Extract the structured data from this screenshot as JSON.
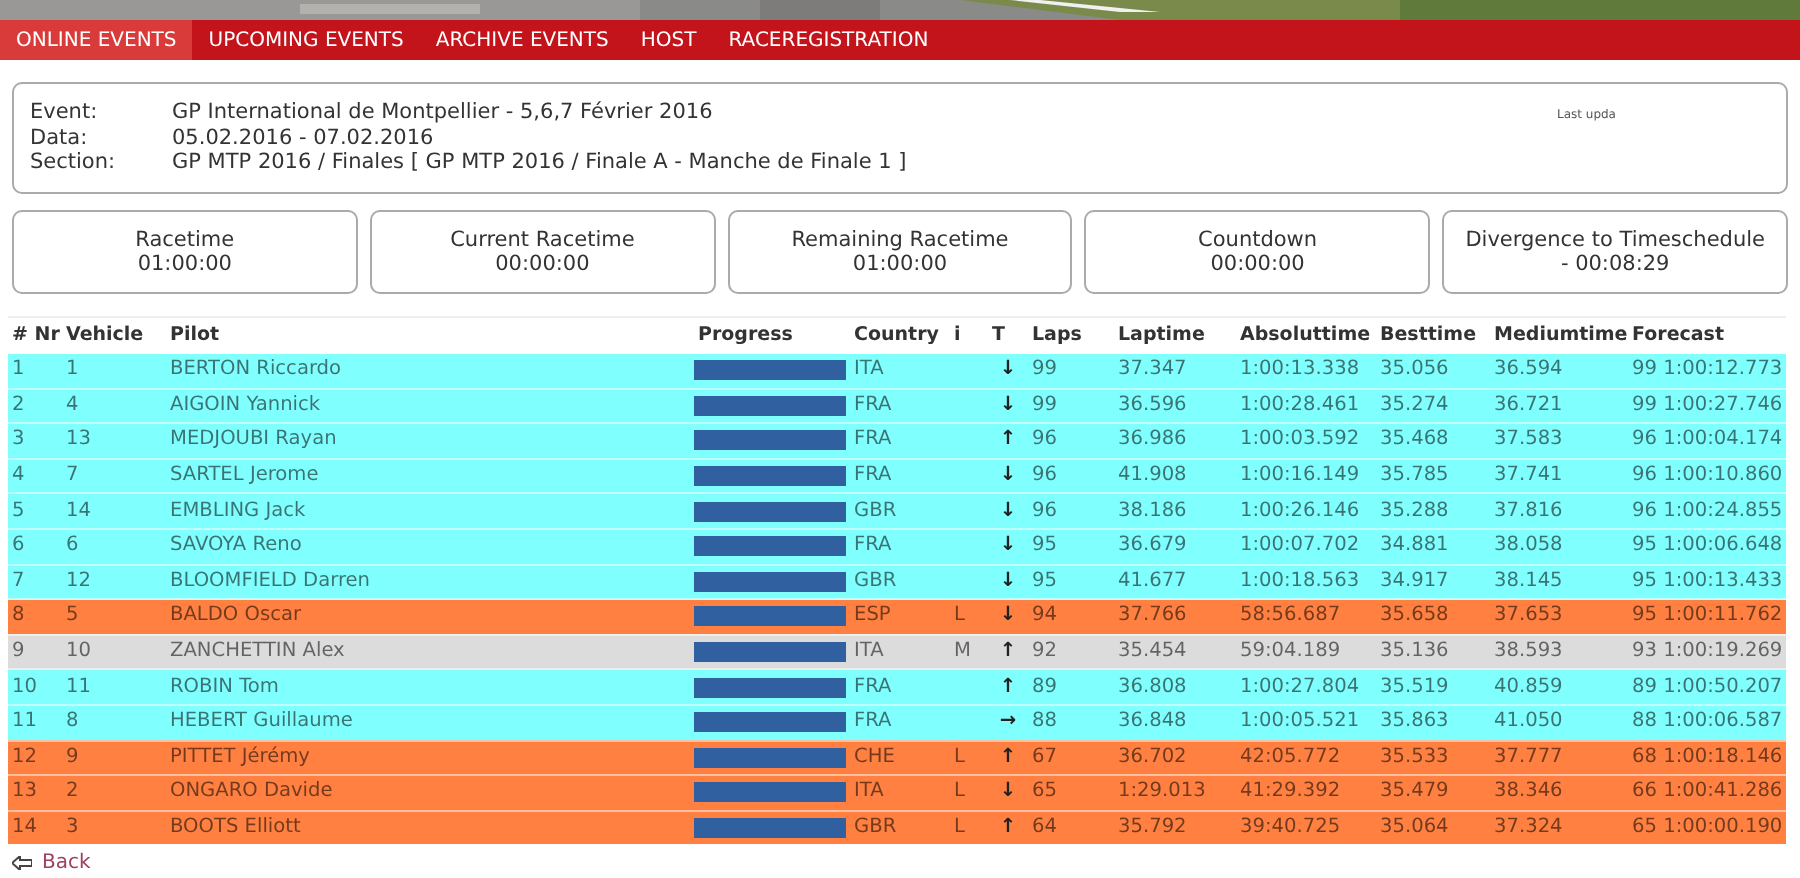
{
  "nav": [
    {
      "label": "ONLINE EVENTS",
      "selected": true
    },
    {
      "label": "UPCOMING EVENTS",
      "selected": false
    },
    {
      "label": "ARCHIVE EVENTS",
      "selected": false
    },
    {
      "label": "HOST",
      "selected": false
    },
    {
      "label": "RACEREGISTRATION",
      "selected": false
    }
  ],
  "event_info": {
    "fields": [
      {
        "label": "Event:",
        "value": "GP International de Montpellier - 5,6,7 Février 2016"
      },
      {
        "label": "Data:",
        "value": "05.02.2016 - 07.02.2016"
      },
      {
        "label": "Section:",
        "value": "GP MTP 2016 / Finales [ GP MTP 2016 / Finale A - Manche de Finale 1 ]"
      }
    ],
    "last_update": "Last upda"
  },
  "timers": [
    {
      "label": "Racetime",
      "value": "01:00:00"
    },
    {
      "label": "Current Racetime",
      "value": "00:00:00"
    },
    {
      "label": "Remaining Racetime",
      "value": "01:00:00"
    },
    {
      "label": "Countdown",
      "value": "00:00:00"
    },
    {
      "label": "Divergence to Timeschedule",
      "value": "- 00:08:29"
    }
  ],
  "table": {
    "columns": [
      "# Nr",
      "Vehicle",
      "Pilot",
      "Progress",
      "Country",
      "i",
      "T",
      "Laps",
      "Laptime",
      "Absoluttime",
      "Besttime",
      "Mediumtime",
      "Forecast"
    ],
    "rows": [
      {
        "color": "#80ffff",
        "nr": "1",
        "vehicle": "1",
        "pilot": "BERTON Riccardo",
        "level": 0.97,
        "country": "ITA",
        "i": "",
        "trend": "↓",
        "laps": "99",
        "laptime": "37.347",
        "absoluttime": "1:00:13.338",
        "besttime": "35.056",
        "mediumtime": "36.594",
        "forecast": "99 1:00:12.773"
      },
      {
        "color": "#80ffff",
        "nr": "2",
        "vehicle": "4",
        "pilot": "AIGOIN Yannick",
        "level": 0.97,
        "country": "FRA",
        "i": "",
        "trend": "↓",
        "laps": "99",
        "laptime": "36.596",
        "absoluttime": "1:00:28.461",
        "besttime": "35.274",
        "mediumtime": "36.721",
        "forecast": "99 1:00:27.746"
      },
      {
        "color": "#80ffff",
        "nr": "3",
        "vehicle": "13",
        "pilot": "MEDJOUBI Rayan",
        "level": 0.97,
        "country": "FRA",
        "i": "",
        "trend": "↑",
        "laps": "96",
        "laptime": "36.986",
        "absoluttime": "1:00:03.592",
        "besttime": "35.468",
        "mediumtime": "37.583",
        "forecast": "96 1:00:04.174"
      },
      {
        "color": "#80ffff",
        "nr": "4",
        "vehicle": "7",
        "pilot": "SARTEL Jerome",
        "level": 0.97,
        "country": "FRA",
        "i": "",
        "trend": "↓",
        "laps": "96",
        "laptime": "41.908",
        "absoluttime": "1:00:16.149",
        "besttime": "35.785",
        "mediumtime": "37.741",
        "forecast": "96 1:00:10.860"
      },
      {
        "color": "#80ffff",
        "nr": "5",
        "vehicle": "14",
        "pilot": "EMBLING Jack",
        "level": 0.97,
        "country": "GBR",
        "i": "",
        "trend": "↓",
        "laps": "96",
        "laptime": "38.186",
        "absoluttime": "1:00:26.146",
        "besttime": "35.288",
        "mediumtime": "37.816",
        "forecast": "96 1:00:24.855"
      },
      {
        "color": "#80ffff",
        "nr": "6",
        "vehicle": "6",
        "pilot": "SAVOYA Reno",
        "level": 0.97,
        "country": "FRA",
        "i": "",
        "trend": "↓",
        "laps": "95",
        "laptime": "36.679",
        "absoluttime": "1:00:07.702",
        "besttime": "34.881",
        "mediumtime": "38.058",
        "forecast": "95 1:00:06.648"
      },
      {
        "color": "#80ffff",
        "nr": "7",
        "vehicle": "12",
        "pilot": "BLOOMFIELD Darren",
        "level": 0.97,
        "country": "GBR",
        "i": "",
        "trend": "↓",
        "laps": "95",
        "laptime": "41.677",
        "absoluttime": "1:00:18.563",
        "besttime": "34.917",
        "mediumtime": "38.145",
        "forecast": "95 1:00:13.433"
      },
      {
        "color": "#ff8040",
        "nr": "8",
        "vehicle": "5",
        "pilot": "BALDO Oscar",
        "level": 0.97,
        "country": "ESP",
        "i": "L",
        "trend": "↓",
        "laps": "94",
        "laptime": "37.766",
        "absoluttime": "58:56.687",
        "besttime": "35.658",
        "mediumtime": "37.653",
        "forecast": "95 1:00:11.762"
      },
      {
        "color": "#dcdcdc",
        "nr": "9",
        "vehicle": "10",
        "pilot": "ZANCHETTIN Alex",
        "level": 0.97,
        "country": "ITA",
        "i": "M",
        "trend": "↑",
        "laps": "92",
        "laptime": "35.454",
        "absoluttime": "59:04.189",
        "besttime": "35.136",
        "mediumtime": "38.593",
        "forecast": "93 1:00:19.269"
      },
      {
        "color": "#80ffff",
        "nr": "10",
        "vehicle": "11",
        "pilot": "ROBIN Tom",
        "level": 0.97,
        "country": "FRA",
        "i": "",
        "trend": "↑",
        "laps": "89",
        "laptime": "36.808",
        "absoluttime": "1:00:27.804",
        "besttime": "35.519",
        "mediumtime": "40.859",
        "forecast": "89 1:00:50.207"
      },
      {
        "color": "#80ffff",
        "nr": "11",
        "vehicle": "8",
        "pilot": "HEBERT Guillaume",
        "level": 0.97,
        "country": "FRA",
        "i": "",
        "trend": "→",
        "laps": "88",
        "laptime": "36.848",
        "absoluttime": "1:00:05.521",
        "besttime": "35.863",
        "mediumtime": "41.050",
        "forecast": "88 1:00:06.587"
      },
      {
        "color": "#ff8040",
        "nr": "12",
        "vehicle": "9",
        "pilot": "PITTET Jérémy",
        "level": 0.97,
        "country": "CHE",
        "i": "L",
        "trend": "↑",
        "laps": "67",
        "laptime": "36.702",
        "absoluttime": "42:05.772",
        "besttime": "35.533",
        "mediumtime": "37.777",
        "forecast": "68 1:00:18.146"
      },
      {
        "color": "#ff8040",
        "nr": "13",
        "vehicle": "2",
        "pilot": "ONGARO Davide",
        "level": 0.97,
        "country": "ITA",
        "i": "L",
        "trend": "↓",
        "laps": "65",
        "laptime": "1:29.013",
        "absoluttime": "41:29.392",
        "besttime": "35.479",
        "mediumtime": "38.346",
        "forecast": "66 1:00:41.286"
      },
      {
        "color": "#ff8040",
        "nr": "14",
        "vehicle": "3",
        "pilot": "BOOTS Elliott",
        "level": 0.97,
        "country": "GBR",
        "i": "L",
        "trend": "↑",
        "laps": "64",
        "laptime": "35.792",
        "absoluttime": "39:40.725",
        "besttime": "35.064",
        "mediumtime": "37.324",
        "forecast": "65 1:00:00.190"
      }
    ]
  },
  "back_link": {
    "label": "Back"
  }
}
